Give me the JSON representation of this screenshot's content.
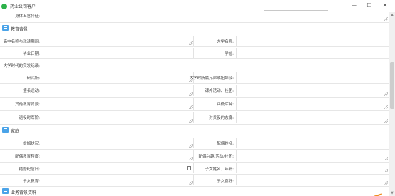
{
  "window": {
    "title": "药业公司客户",
    "controls": [
      "—",
      "☐",
      "✕"
    ]
  },
  "top_field": {
    "label": "身体五官特征:"
  },
  "sections": [
    {
      "title": "教育背景",
      "rows": [
        {
          "left_label": "高中名称与就读期间:",
          "right_label": "大学名称:"
        },
        {
          "left_label": "毕业日期:",
          "right_label": "学位:"
        },
        {
          "left_label": "大学时代的突发纪录:"
        },
        {
          "left_label": "研究所:",
          "right_label": "大学时所属兄弟或姐妹会:"
        },
        {
          "left_label": "擅长运动:",
          "right_label": "课外活动、社团:"
        },
        {
          "left_label": "其他教育背景:",
          "right_label": "兵役军种:"
        },
        {
          "left_label": "退役时军阶:",
          "right_label": "对兵役的态度:"
        }
      ]
    },
    {
      "title": "家庭",
      "rows": [
        {
          "left_label": "婚姻状况:",
          "right_label": "配偶姓名:"
        },
        {
          "left_label": "配偶教育程度:",
          "right_label": "配偶兴趣/活动/社团:"
        },
        {
          "left_label": "结婚纪念日:",
          "right_label": "子女姓名、年龄:"
        },
        {
          "left_label": "子女教育:",
          "right_label": "子女喜好:"
        }
      ]
    },
    {
      "title": "业务背景资料"
    }
  ],
  "icons": {
    "app": "app-logo-icon",
    "section": "section-header-icon",
    "calendar": "calendar-icon"
  },
  "colors": {
    "section_rule": "#3c8ee0",
    "section_icon": "#4aa3e8",
    "app_icon": "#2db24a"
  }
}
